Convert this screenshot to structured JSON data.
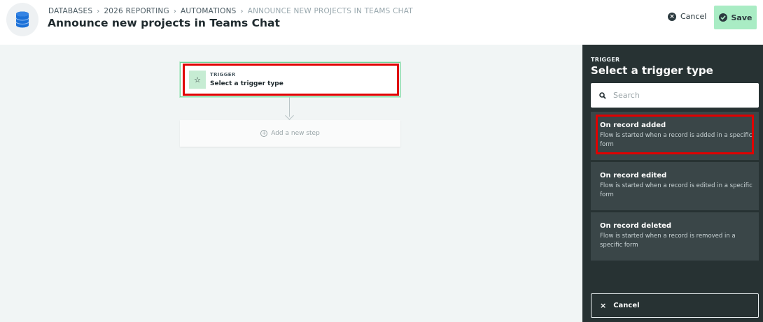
{
  "header": {
    "breadcrumbs": [
      "DATABASES",
      "2026 REPORTING",
      "AUTOMATIONS",
      "ANNOUNCE NEW PROJECTS IN TEAMS CHAT"
    ],
    "title": "Announce new projects in Teams Chat",
    "cancel_label": "Cancel",
    "save_label": "Save"
  },
  "canvas": {
    "trigger_kicker": "TRIGGER",
    "trigger_label": "Select a trigger type",
    "add_step_label": "Add a new step"
  },
  "panel": {
    "kicker": "TRIGGER",
    "title": "Select a trigger type",
    "search_placeholder": "Search",
    "options": [
      {
        "name": "On record added",
        "description": "Flow is started when a record is added in a specific form"
      },
      {
        "name": "On record edited",
        "description": "Flow is started when a record is edited in a specific form"
      },
      {
        "name": "On record deleted",
        "description": "Flow is started when a record is removed in a specific form"
      }
    ],
    "cancel_label": "Cancel"
  },
  "colors": {
    "save_button": "#a9ecc4",
    "panel_bg": "#273233",
    "option_bg": "#3a4648",
    "highlight": "#e00000",
    "canvas_bg": "#f1f5f5"
  },
  "icons": {
    "logo": "database-icon",
    "trigger": "star-icon",
    "search": "search-icon",
    "cancel": "close-icon",
    "save": "check-icon"
  }
}
